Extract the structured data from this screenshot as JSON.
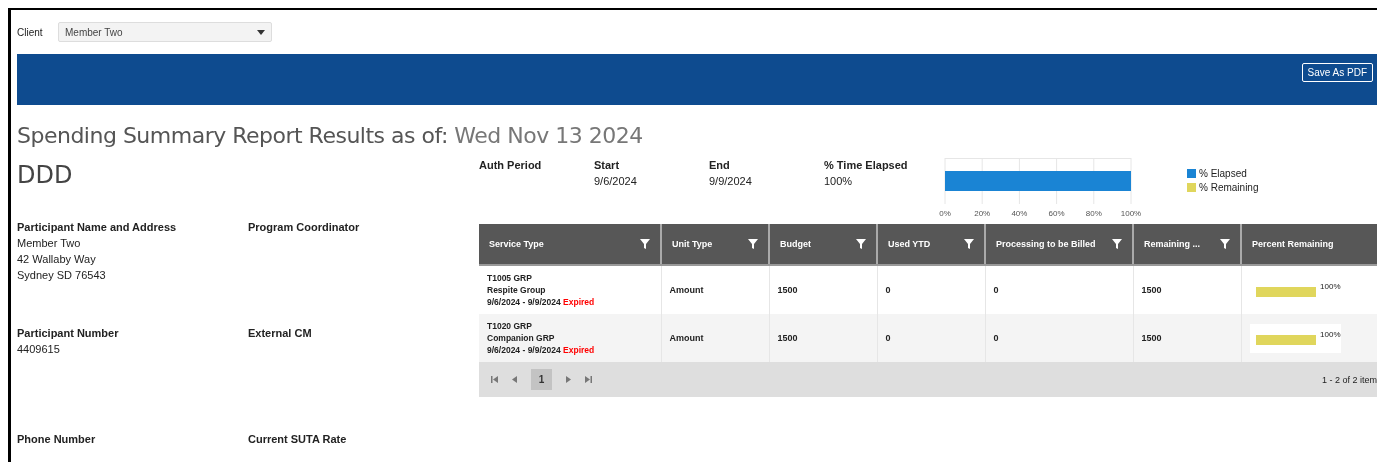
{
  "client": {
    "label": "Client",
    "value": "Member Two"
  },
  "toolbar": {
    "button": "Save As PDF"
  },
  "title": {
    "text": "Spending Summary Report Results as of:",
    "date": "Wed Nov 13 2024"
  },
  "code": "DDD",
  "info_fields": [
    {
      "label": "Participant Name and Address",
      "lines": [
        "Member Two",
        "42 Wallaby Way",
        "Sydney SD 76543"
      ]
    },
    {
      "label": "Program Coordinator"
    },
    {
      "label": "Participant Number",
      "lines": [
        "4409615"
      ]
    },
    {
      "label": "External CM"
    },
    {
      "label": "Phone Number"
    },
    {
      "label": "Current SUTA Rate"
    }
  ],
  "auth": [
    {
      "label": "Auth Period"
    },
    {
      "label": "Start",
      "value": "9/6/2024"
    },
    {
      "label": "End",
      "value": "9/9/2024"
    },
    {
      "label": "% Time Elapsed",
      "value": "100%"
    }
  ],
  "chart_data": {
    "type": "bar",
    "orientation": "horizontal",
    "stacked": true,
    "grid": true,
    "xlim": [
      0,
      100
    ],
    "xticks": [
      {
        "value": 0,
        "label": "0%"
      },
      {
        "value": 20,
        "label": "20%"
      },
      {
        "value": 40,
        "label": "40%"
      },
      {
        "value": 60,
        "label": "60%"
      },
      {
        "value": 80,
        "label": "80%"
      },
      {
        "value": 100,
        "label": "100%"
      }
    ],
    "series": [
      {
        "name": "% Elapsed",
        "color": "#1a84d4",
        "values": [
          100
        ]
      },
      {
        "name": "% Remaining",
        "color": "#e0d65c",
        "values": [
          0
        ]
      }
    ]
  },
  "table": {
    "columns": [
      {
        "label": "Service Type",
        "filter": true
      },
      {
        "label": "Unit Type",
        "filter": true
      },
      {
        "label": "Budget",
        "filter": true
      },
      {
        "label": "Used YTD",
        "filter": true
      },
      {
        "label": "Processing to be Billed",
        "filter": true
      },
      {
        "label": "Remaining ...",
        "filter": true
      },
      {
        "label": "Percent Remaining",
        "filter": false
      }
    ],
    "rows": [
      {
        "code": "T1005 GRP",
        "name": "Respite Group",
        "period": "9/6/2024 - 9/9/2024",
        "status": "Expired",
        "unit_type": "Amount",
        "budget": "1500",
        "used_ytd": "0",
        "processing": "0",
        "remaining": "1500",
        "level": 1,
        "percent": "100%"
      },
      {
        "code": "T1020 GRP",
        "name": "Companion GRP",
        "period": "9/6/2024 - 9/9/2024",
        "status": "Expired",
        "unit_type": "Amount",
        "budget": "1500",
        "used_ytd": "0",
        "processing": "0",
        "remaining": "1500",
        "level": 1,
        "percent": "100%"
      }
    ]
  },
  "pager": {
    "pages": [
      {
        "label": "1",
        "selected": true
      }
    ],
    "summary": "1 - 2 of 2 item"
  }
}
